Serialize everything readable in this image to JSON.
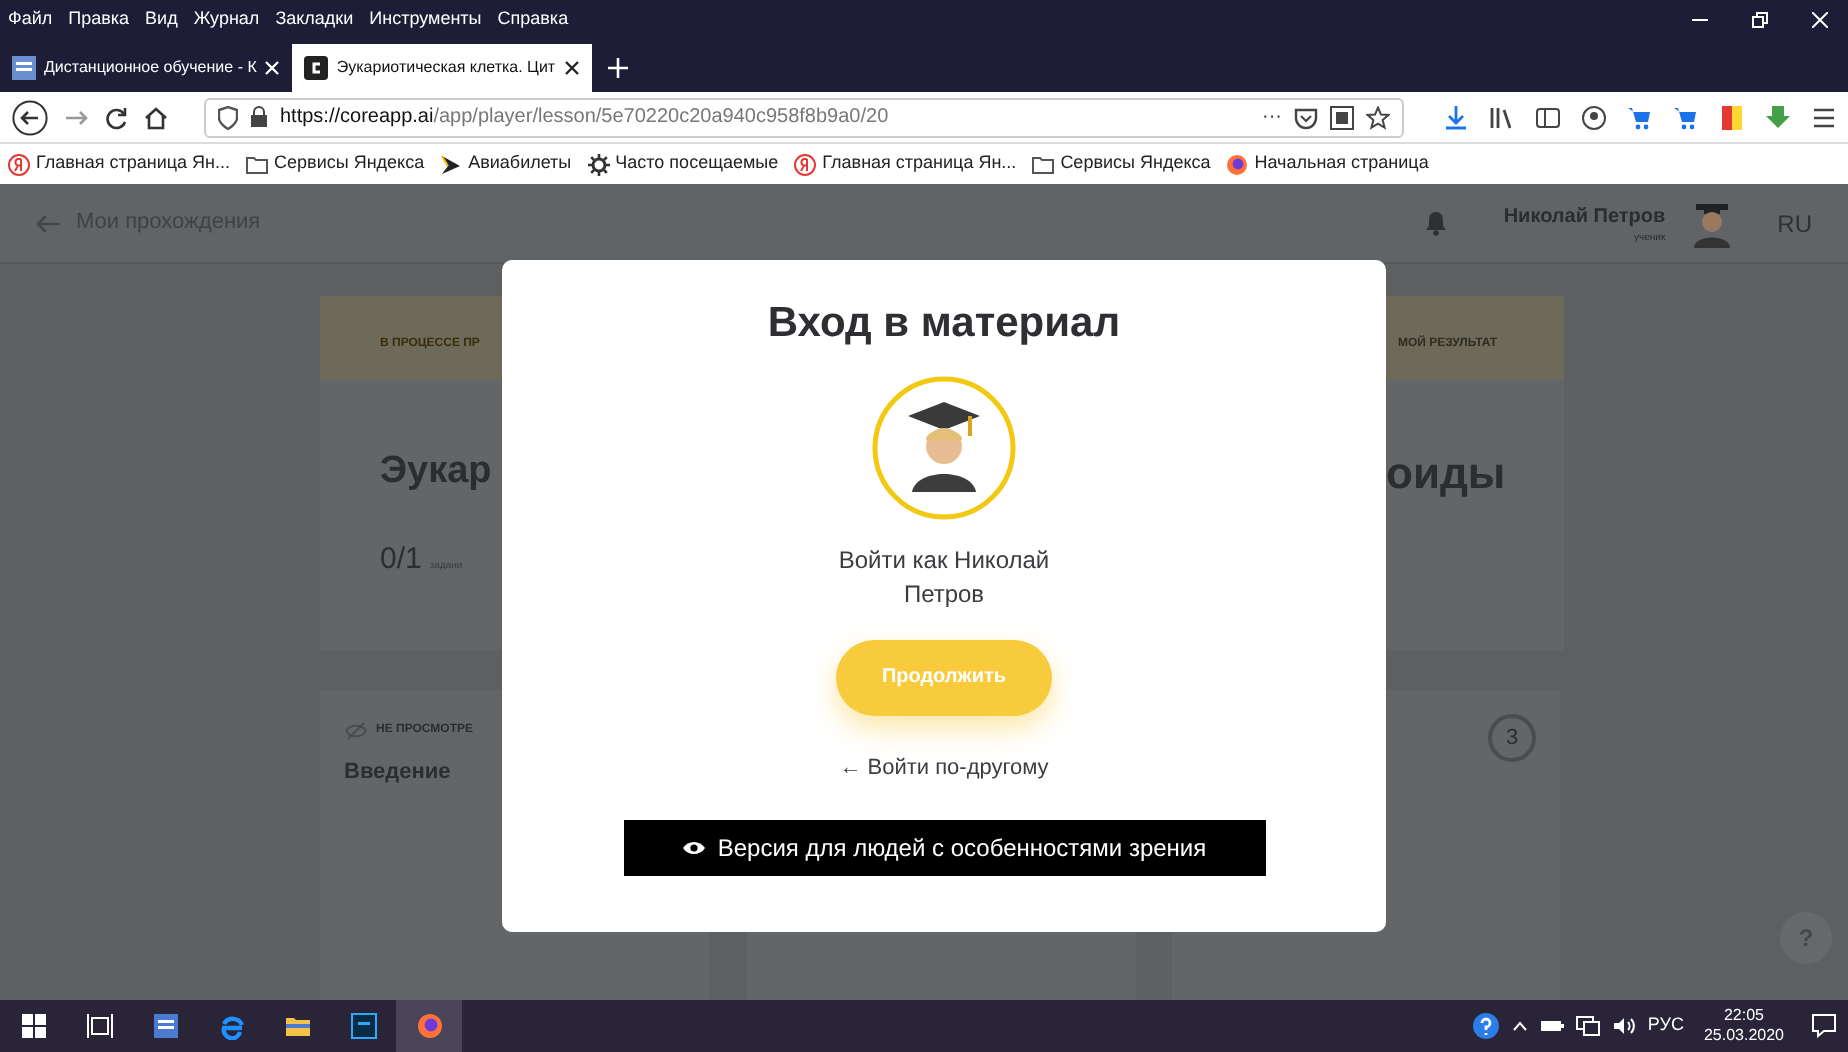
{
  "menu_bar": {
    "items": [
      "Файл",
      "Правка",
      "Вид",
      "Журнал",
      "Закладки",
      "Инструменты",
      "Справка"
    ]
  },
  "tabs": [
    {
      "label": "Дистанционное обучение - К",
      "selected": false
    },
    {
      "label": "Эукариотическая клетка. Цит",
      "selected": true
    }
  ],
  "address_bar": {
    "url_host": "https://coreapp.ai",
    "url_path": "/app/player/lesson/5e70220c20a940c958f8b9a0/20",
    "more": "···"
  },
  "bookmarks": [
    {
      "label": "Главная страница Ян...",
      "kind": "yandex"
    },
    {
      "label": "Сервисы Яндекса",
      "kind": "folder"
    },
    {
      "label": "Авиабилеты",
      "kind": "plane"
    },
    {
      "label": "Часто посещаемые",
      "kind": "gear"
    },
    {
      "label": "Главная страница Ян...",
      "kind": "yandex"
    },
    {
      "label": "Сервисы Яндекса",
      "kind": "folder"
    },
    {
      "label": "Начальная страница",
      "kind": "firefox"
    }
  ],
  "header": {
    "back": "Мои прохождения",
    "user_name": "Николай Петров",
    "user_role": "ученик",
    "language": "RU"
  },
  "lesson_card": {
    "status": "В ПРОЦЕССЕ ПР",
    "result_label": "МОЙ РЕЗУЛЬТАТ",
    "title_left": "Эукар",
    "title_right": "оиды",
    "progress": "0/1",
    "progress_label": "задани"
  },
  "content_cards": [
    {
      "status": "НЕ ПРОСМОТРЕ",
      "title": "Введение"
    },
    {
      "number": "3"
    }
  ],
  "modal": {
    "title": "Вход в материал",
    "login_as": "Войти как Николай Петров",
    "continue": "Продолжить",
    "other_login": "← Войти по-другому",
    "accessibility": "Версия для людей с особенностями зрения"
  },
  "help": "?",
  "taskbar": {
    "language": "РУС",
    "time": "22:05",
    "date": "25.03.2020"
  }
}
